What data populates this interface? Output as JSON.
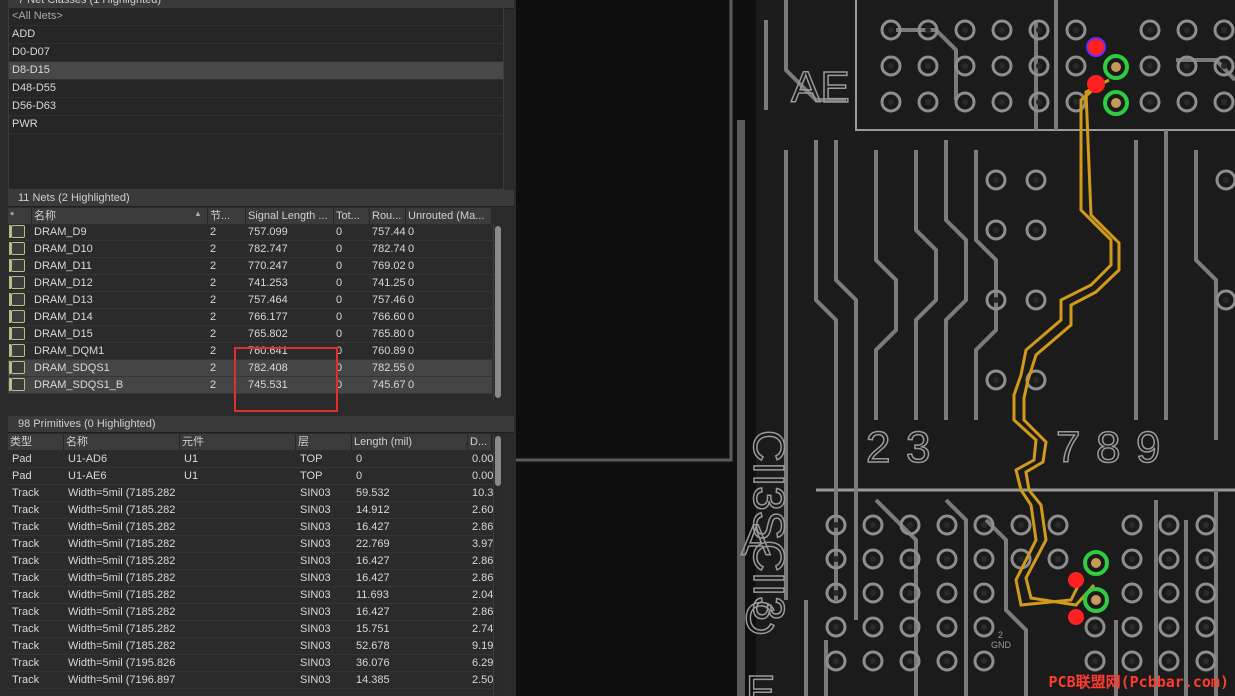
{
  "net_classes": {
    "title": "7 Net Classes (1 Highlighted)",
    "items": [
      {
        "label": "<All Nets>",
        "muted": true,
        "selected": false
      },
      {
        "label": "ADD",
        "selected": false
      },
      {
        "label": "D0-D07",
        "selected": false
      },
      {
        "label": "D8-D15",
        "selected": true
      },
      {
        "label": "D48-D55",
        "selected": false
      },
      {
        "label": "D56-D63",
        "selected": false
      },
      {
        "label": "PWR",
        "selected": false
      }
    ]
  },
  "nets": {
    "title": "11 Nets (2 Highlighted)",
    "columns": [
      "*",
      "名称",
      "节...",
      "Signal Length ...",
      "Tot...",
      "Rou...",
      "Unrouted (Ma..."
    ],
    "rows": [
      {
        "name": "DRAM_D9",
        "nodes": "2",
        "signal_length": "757.099",
        "total": "0",
        "routed": "757.44",
        "unrouted": "0"
      },
      {
        "name": "DRAM_D10",
        "nodes": "2",
        "signal_length": "782.747",
        "total": "0",
        "routed": "782.74",
        "unrouted": "0"
      },
      {
        "name": "DRAM_D11",
        "nodes": "2",
        "signal_length": "770.247",
        "total": "0",
        "routed": "769.02",
        "unrouted": "0"
      },
      {
        "name": "DRAM_D12",
        "nodes": "2",
        "signal_length": "741.253",
        "total": "0",
        "routed": "741.25",
        "unrouted": "0"
      },
      {
        "name": "DRAM_D13",
        "nodes": "2",
        "signal_length": "757.464",
        "total": "0",
        "routed": "757.46",
        "unrouted": "0"
      },
      {
        "name": "DRAM_D14",
        "nodes": "2",
        "signal_length": "766.177",
        "total": "0",
        "routed": "766.60",
        "unrouted": "0"
      },
      {
        "name": "DRAM_D15",
        "nodes": "2",
        "signal_length": "765.802",
        "total": "0",
        "routed": "765.80",
        "unrouted": "0"
      },
      {
        "name": "DRAM_DQM1",
        "nodes": "2",
        "signal_length": "760.641",
        "total": "0",
        "routed": "760.89",
        "unrouted": "0"
      },
      {
        "name": "DRAM_SDQS1",
        "nodes": "2",
        "signal_length": "782.408",
        "total": "0",
        "routed": "782.55",
        "unrouted": "0",
        "selected": true
      },
      {
        "name": "DRAM_SDQS1_B",
        "nodes": "2",
        "signal_length": "745.531",
        "total": "0",
        "routed": "745.67",
        "unrouted": "0",
        "selected": true
      }
    ]
  },
  "primitives": {
    "title": "98 Primitives (0 Highlighted)",
    "columns": [
      "类型",
      "名称",
      "元件",
      "层",
      "Length (mil)",
      "D..."
    ],
    "rows": [
      {
        "type": "Pad",
        "name": "U1-AD6",
        "component": "U1",
        "layer": "TOP",
        "length": "0",
        "d": "0.00"
      },
      {
        "type": "Pad",
        "name": "U1-AE6",
        "component": "U1",
        "layer": "TOP",
        "length": "0",
        "d": "0.00"
      },
      {
        "type": "Track",
        "name": "Width=5mil (7185.282",
        "component": "",
        "layer": "SIN03",
        "length": "59.532",
        "d": "10.3"
      },
      {
        "type": "Track",
        "name": "Width=5mil (7185.282",
        "component": "",
        "layer": "SIN03",
        "length": "14.912",
        "d": "2.60"
      },
      {
        "type": "Track",
        "name": "Width=5mil (7185.282",
        "component": "",
        "layer": "SIN03",
        "length": "16.427",
        "d": "2.86"
      },
      {
        "type": "Track",
        "name": "Width=5mil (7185.282",
        "component": "",
        "layer": "SIN03",
        "length": "22.769",
        "d": "3.97"
      },
      {
        "type": "Track",
        "name": "Width=5mil (7185.282",
        "component": "",
        "layer": "SIN03",
        "length": "16.427",
        "d": "2.86"
      },
      {
        "type": "Track",
        "name": "Width=5mil (7185.282",
        "component": "",
        "layer": "SIN03",
        "length": "16.427",
        "d": "2.86"
      },
      {
        "type": "Track",
        "name": "Width=5mil (7185.282",
        "component": "",
        "layer": "SIN03",
        "length": "11.693",
        "d": "2.04"
      },
      {
        "type": "Track",
        "name": "Width=5mil (7185.282",
        "component": "",
        "layer": "SIN03",
        "length": "16.427",
        "d": "2.86"
      },
      {
        "type": "Track",
        "name": "Width=5mil (7185.282",
        "component": "",
        "layer": "SIN03",
        "length": "15.751",
        "d": "2.74"
      },
      {
        "type": "Track",
        "name": "Width=5mil (7185.282",
        "component": "",
        "layer": "SIN03",
        "length": "52.678",
        "d": "9.19"
      },
      {
        "type": "Track",
        "name": "Width=5mil (7195.826",
        "component": "",
        "layer": "SIN03",
        "length": "36.076",
        "d": "6.29"
      },
      {
        "type": "Track",
        "name": "Width=5mil (7196.897",
        "component": "",
        "layer": "SIN03",
        "length": "14.385",
        "d": "2.50"
      }
    ]
  },
  "pcb": {
    "labels": [
      "AE",
      "2",
      "3",
      "7",
      "8",
      "9",
      "A",
      "C",
      "E"
    ],
    "gnd_label": "GND",
    "gnd_num": "2",
    "vertical_text": "CII3SCII3",
    "watermark": "PCB联盟网(Pcbbar.com)",
    "colors": {
      "trace": "#d19a1a",
      "pad": "#8e8e8e",
      "via_red": "#ff2020",
      "via_green": "#2ecc40",
      "outline": "#9a9a9a"
    }
  }
}
